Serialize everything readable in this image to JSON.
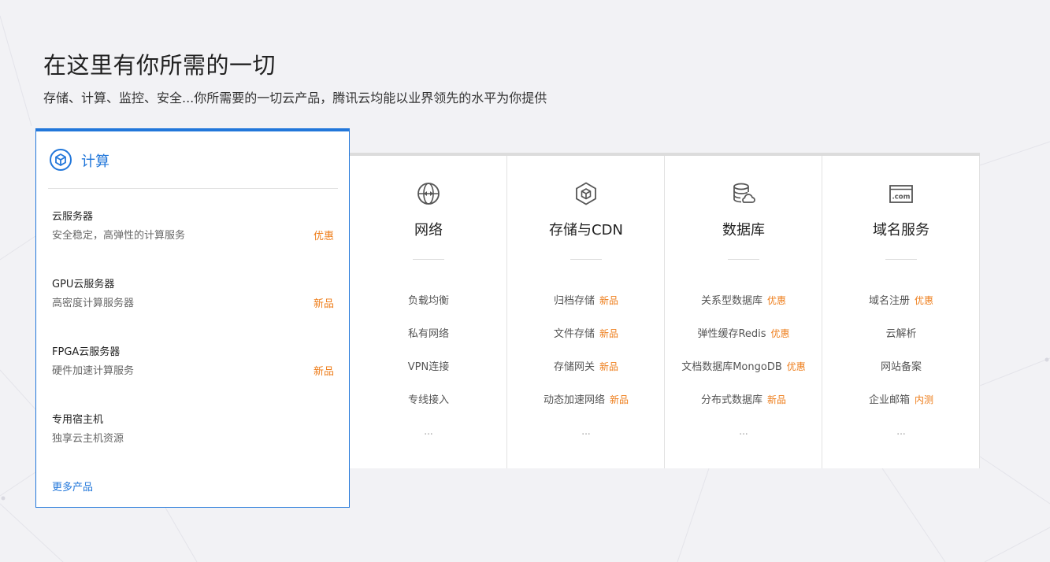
{
  "hero": {
    "title": "在这里有你所需的一切",
    "subtitle": "存储、计算、监控、安全...你所需要的一切云产品，腾讯云均能以业界领先的水平为你提供"
  },
  "featured": {
    "title": "计算",
    "icon": "cube-circle-icon",
    "items": [
      {
        "name": "云服务器",
        "desc": "安全稳定，高弹性的计算服务",
        "tag": "优惠"
      },
      {
        "name": "GPU云服务器",
        "desc": "高密度计算服务器",
        "tag": "新品"
      },
      {
        "name": "FPGA云服务器",
        "desc": "硬件加速计算服务",
        "tag": "新品"
      },
      {
        "name": "专用宿主机",
        "desc": "独享云主机资源",
        "tag": ""
      }
    ],
    "more_label": "更多产品"
  },
  "columns": [
    {
      "title": "网络",
      "icon": "globe-icon",
      "items": [
        {
          "label": "负载均衡",
          "tag": ""
        },
        {
          "label": "私有网络",
          "tag": ""
        },
        {
          "label": "VPN连接",
          "tag": ""
        },
        {
          "label": "专线接入",
          "tag": ""
        }
      ],
      "more": "..."
    },
    {
      "title": "存储与CDN",
      "icon": "cube-hexagon-icon",
      "items": [
        {
          "label": "归档存储",
          "tag": "新品"
        },
        {
          "label": "文件存储",
          "tag": "新品"
        },
        {
          "label": "存储网关",
          "tag": "新品"
        },
        {
          "label": "动态加速网络",
          "tag": "新品"
        }
      ],
      "more": "..."
    },
    {
      "title": "数据库",
      "icon": "database-cloud-icon",
      "items": [
        {
          "label": "关系型数据库",
          "tag": "优惠"
        },
        {
          "label": "弹性缓存Redis",
          "tag": "优惠"
        },
        {
          "label": "文档数据库MongoDB",
          "tag": "优惠"
        },
        {
          "label": "分布式数据库",
          "tag": "新品"
        }
      ],
      "more": "..."
    },
    {
      "title": "域名服务",
      "icon": "dotcom-icon",
      "icon_text": ".com",
      "items": [
        {
          "label": "域名注册",
          "tag": "优惠"
        },
        {
          "label": "云解析",
          "tag": ""
        },
        {
          "label": "网站备案",
          "tag": ""
        },
        {
          "label": "企业邮箱",
          "tag": "内测"
        }
      ],
      "more": "..."
    }
  ],
  "colors": {
    "accent": "#2277da",
    "tag": "#ee7d1a",
    "background": "#f2f2f5"
  }
}
